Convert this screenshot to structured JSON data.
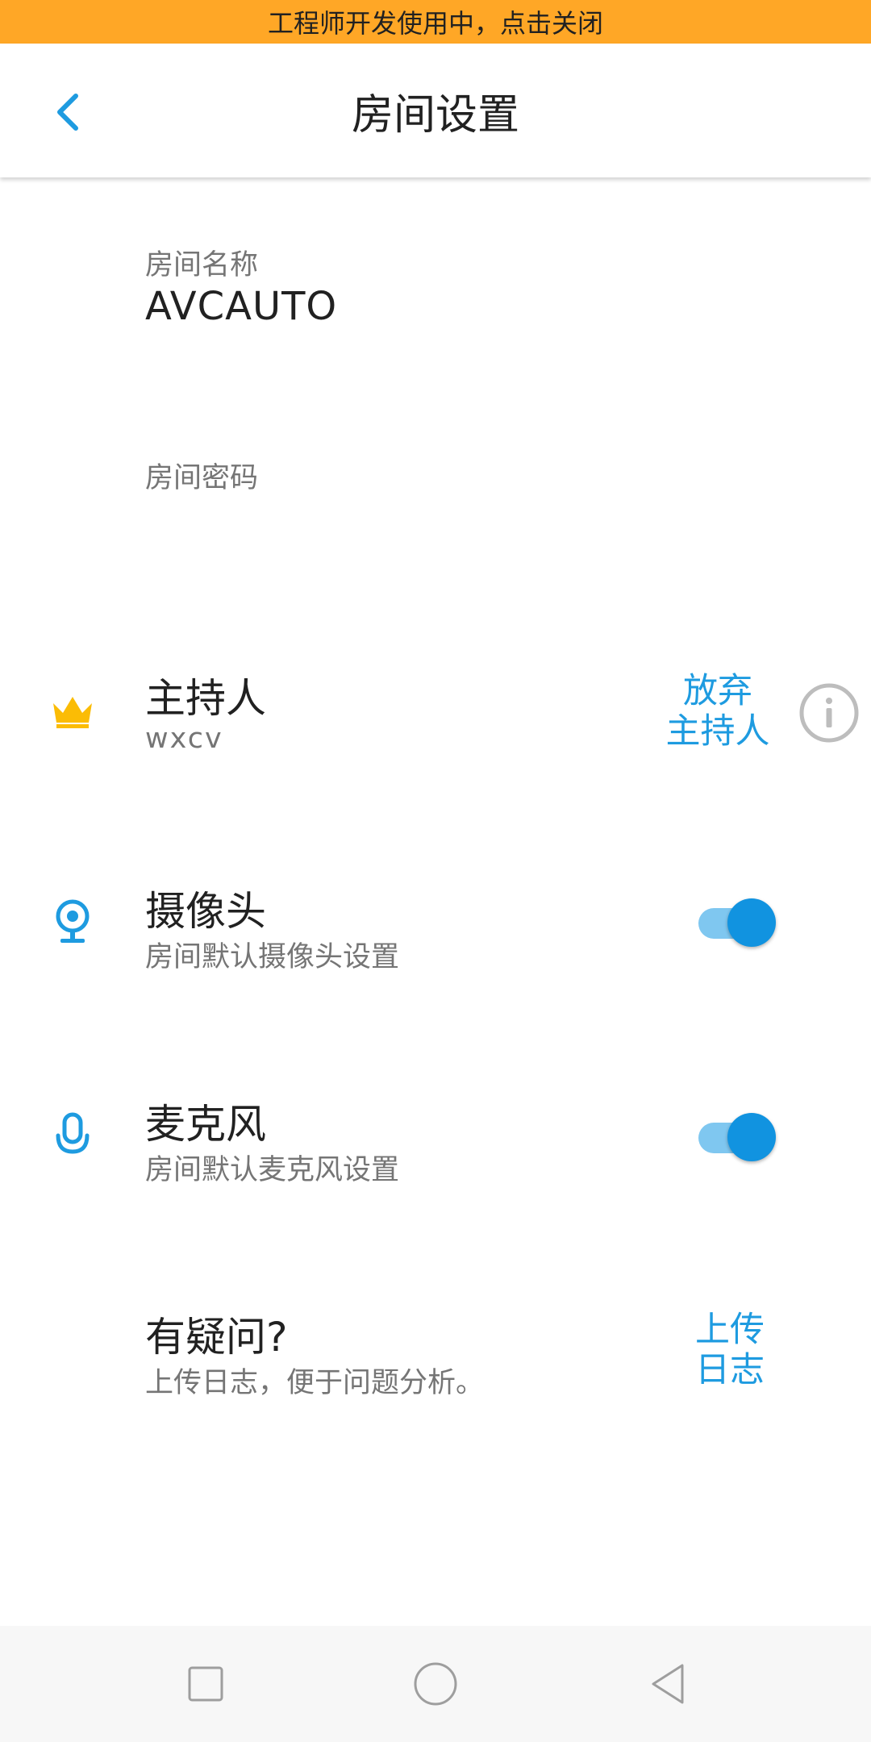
{
  "banner": {
    "text": "工程师开发使用中，点击关闭"
  },
  "appbar": {
    "title": "房间设置",
    "back_icon": "chevron-left-icon"
  },
  "room_name": {
    "label": "房间名称",
    "value": "AVCAUTO"
  },
  "room_password": {
    "label": "房间密码",
    "value": ""
  },
  "host": {
    "icon": "crown-icon",
    "title": "主持人",
    "subtitle": "wxcv",
    "action_line1": "放弃",
    "action_line2": "主持人",
    "info_icon": "info-icon"
  },
  "camera": {
    "icon": "webcam-icon",
    "title": "摄像头",
    "subtitle": "房间默认摄像头设置",
    "enabled": true
  },
  "microphone": {
    "icon": "microphone-icon",
    "title": "麦克风",
    "subtitle": "房间默认麦克风设置",
    "enabled": true
  },
  "feedback": {
    "title": "有疑问?",
    "subtitle": "上传日志，便于问题分析。",
    "action_line1": "上传",
    "action_line2": "日志"
  },
  "navbar": {
    "items": [
      "recents-icon",
      "home-icon",
      "back-icon"
    ]
  },
  "colors": {
    "banner": "#FFA726",
    "accent": "#1E9BE0",
    "crown": "#FBBC05",
    "switch_thumb": "#1193E0",
    "switch_track": "#7FC7F0"
  }
}
